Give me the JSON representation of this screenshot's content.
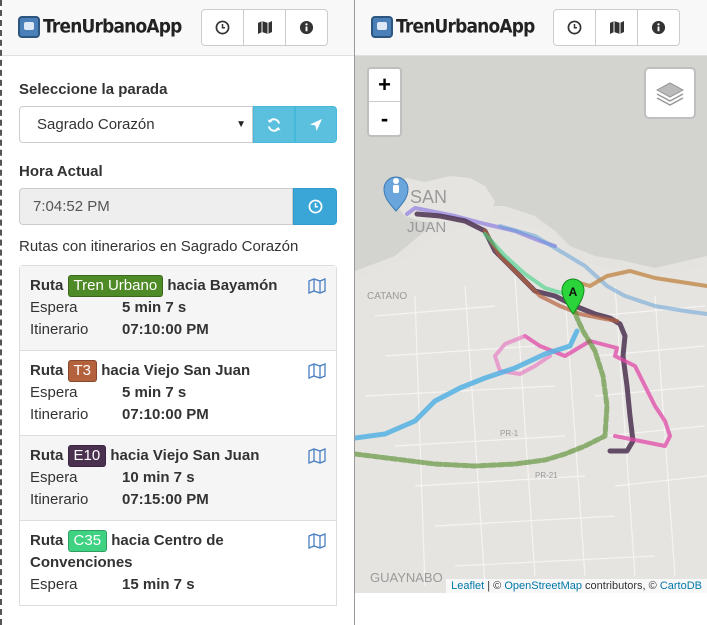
{
  "app": {
    "brand": "TrenUrbanoApp"
  },
  "nav": {
    "buttons": [
      "clock-icon",
      "map-icon",
      "info-icon"
    ]
  },
  "stop": {
    "label": "Seleccione la parada",
    "selected": "Sagrado Corazón"
  },
  "time": {
    "label": "Hora Actual",
    "value": "7:04:52 PM"
  },
  "routes_title": "Rutas con itinerarios en Sagrado Corazón",
  "route_word": "Ruta",
  "toward_word": "hacia",
  "wait_label": "Espera",
  "schedule_label": "Itinerario",
  "routes": [
    {
      "badge": "Tren Urbano",
      "color": "#4e8a25",
      "dest": "Bayamón",
      "wait": "5 min 7 s",
      "schedule": "07:10:00 PM"
    },
    {
      "badge": "T3",
      "color": "#b4613d",
      "dest": "Viejo San Juan",
      "wait": "5 min 7 s",
      "schedule": "07:10:00 PM"
    },
    {
      "badge": "E10",
      "color": "#4b3150",
      "dest": "Viejo San Juan",
      "wait": "10 min 7 s",
      "schedule": "07:15:00 PM"
    },
    {
      "badge": "C35",
      "color": "#3fd283",
      "dest": "Centro de Convenciones",
      "wait": "15 min 7 s",
      "schedule": ""
    }
  ],
  "map": {
    "zoom_in": "+",
    "zoom_out": "-",
    "marker_label": "A",
    "place_labels": [
      "SAN",
      "JUAN",
      "CATANO",
      "GUAYNABO",
      "PR-21",
      "PR-1"
    ],
    "attribution": {
      "leaflet": "Leaflet",
      "sep1": " | © ",
      "osm": "OpenStreetMap",
      "mid": " contributors, © ",
      "carto": "CartoDB"
    }
  }
}
